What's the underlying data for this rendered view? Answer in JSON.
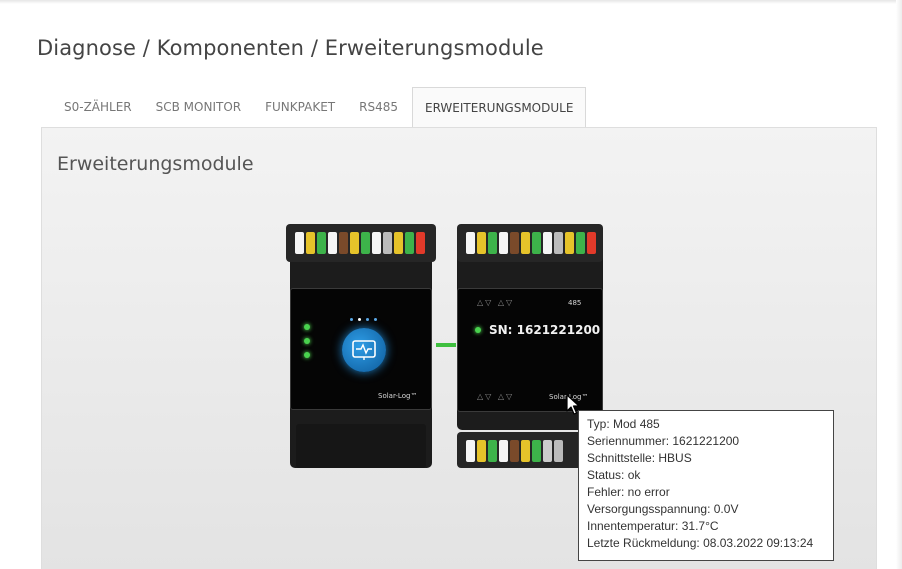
{
  "breadcrumb": "Diagnose / Komponenten / Erweiterungsmodule",
  "tabs": [
    {
      "label": "S0-ZÄHLER"
    },
    {
      "label": "SCB MONITOR"
    },
    {
      "label": "FUNKPAKET"
    },
    {
      "label": "RS485"
    },
    {
      "label": "ERWEITERUNGSMODULE"
    }
  ],
  "active_tab": "ERWEITERUNGSMODULE",
  "panel": {
    "title": "Erweiterungsmodule"
  },
  "modules": {
    "left": {
      "brand": "Solar-Log™"
    },
    "right": {
      "sn_label": "SN: 1621221200",
      "port_label": "485",
      "arrows": "△▽  △▽",
      "brand": "Solar-Log™"
    }
  },
  "tooltip": {
    "lines": [
      "Typ: Mod 485",
      "Seriennummer: 1621221200",
      "Schnittstelle: HBUS",
      "Status: ok",
      "Fehler: no error",
      "Versorgungsspannung: 0.0V",
      "Innentemperatur: 31.7°C",
      "Letzte Rückmeldung: 08.03.2022 09:13:24"
    ]
  },
  "colors": {
    "led": "#49d24e",
    "accent_blue": "#1f7fc4",
    "connector_green": "#3fbf3f"
  },
  "icons": {
    "cursor": "mouse-pointer-icon",
    "monitor": "monitor-pulse-icon"
  }
}
